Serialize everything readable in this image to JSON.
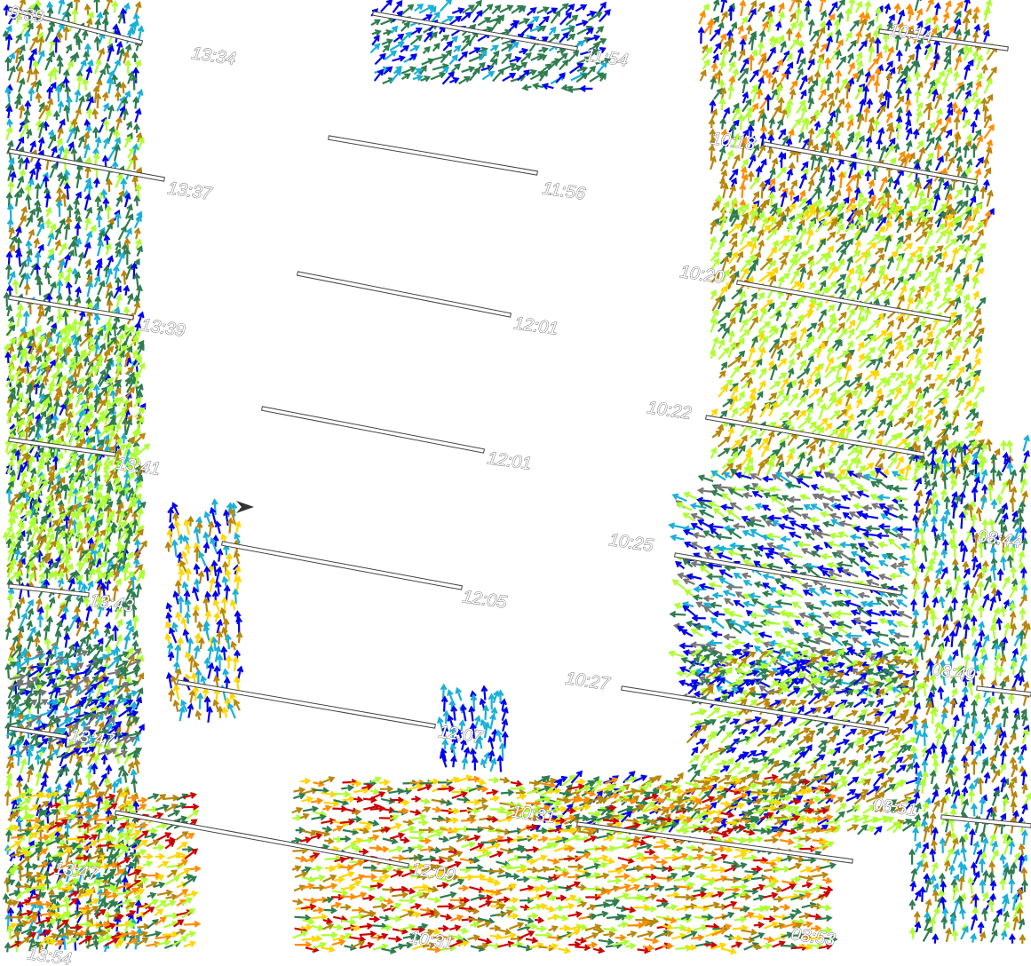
{
  "view": {
    "background": "#ffffff",
    "speed_colors": [
      "#0000ee",
      "#1ab0d8",
      "#2e7d4f",
      "#adff2f",
      "#b8860b",
      "#ffd700",
      "#ff8c00",
      "#cc0000",
      "#777777"
    ]
  },
  "track_labels": [
    "13:34",
    "13:37",
    "13:39",
    "13:41",
    "13:43",
    "13:47",
    "13:47",
    "13:54",
    "11:54",
    "11:56",
    "12:01",
    "12:01",
    "12:05",
    "12:07",
    "12:09",
    "10:31",
    "10:18",
    "10:20",
    "10:22",
    "10:25",
    "10:27",
    "10:31",
    "08:44",
    "08:49",
    "08:51",
    "08:53",
    "10:14",
    "9:39"
  ],
  "marker": {
    "icon": "chevron-right-icon"
  }
}
